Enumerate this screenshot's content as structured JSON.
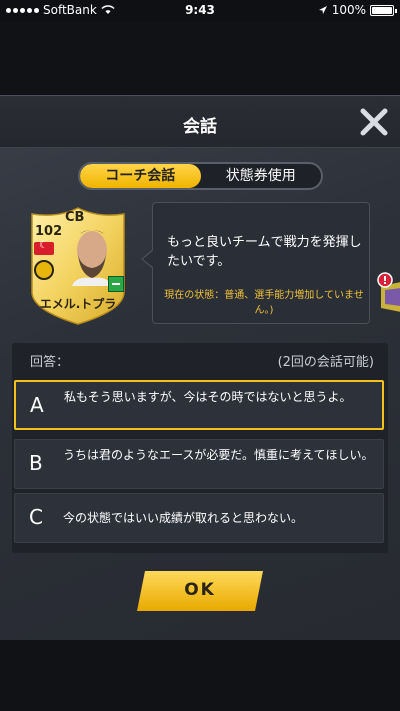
{
  "status_bar": {
    "carrier": "SoftBank",
    "time": "9:43",
    "battery": "100%"
  },
  "dialog": {
    "title": "会話",
    "tabs": [
      {
        "label": "コーチ会話",
        "active": true
      },
      {
        "label": "状態券使用",
        "active": false
      }
    ]
  },
  "player": {
    "rating": "102",
    "position": "CB",
    "name": "エメル.トプラ"
  },
  "bubble": {
    "message": "もっと良いチームで戦力を発揮したいです。",
    "state": "現在の状態：普通、選手能力増加していません。)"
  },
  "answers": {
    "label": "回答：",
    "count": "(2回の会話可能)",
    "options": [
      {
        "letter": "A",
        "text": "私もそう思いますが、今はその時ではないと思うよ。"
      },
      {
        "letter": "B",
        "text": "うちは君のようなエースが必要だ。慎重に考えてほしい。"
      },
      {
        "letter": "C",
        "text": "今の状態ではいい成績が取れると思わない。"
      }
    ]
  },
  "ok_button": {
    "label": "OK"
  },
  "colors": {
    "accent": "#f2c21a",
    "state_text": "#f0c23a"
  }
}
